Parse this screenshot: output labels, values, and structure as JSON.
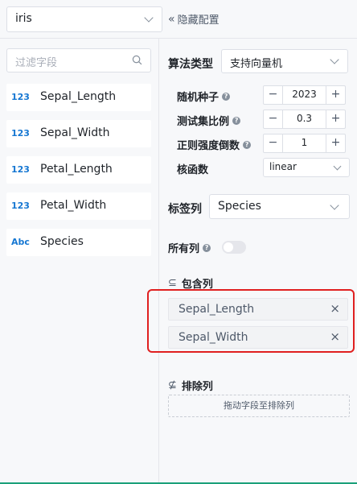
{
  "topbar": {
    "dataset_value": "iris",
    "hide_config_label": "隐藏配置",
    "hide_glyph": "«"
  },
  "left": {
    "search_placeholder": "过滤字段",
    "fields": [
      {
        "type": "123",
        "name": "Sepal_Length"
      },
      {
        "type": "123",
        "name": "Sepal_Width"
      },
      {
        "type": "123",
        "name": "Petal_Length"
      },
      {
        "type": "123",
        "name": "Petal_Width"
      },
      {
        "type": "Abc",
        "name": "Species"
      }
    ]
  },
  "right": {
    "algorithm_label": "算法类型",
    "algorithm_value": "支持向量机",
    "params": {
      "seed_label": "随机种子",
      "seed_value": "2023",
      "test_ratio_label": "测试集比例",
      "test_ratio_value": "0.3",
      "reg_label": "正则强度倒数",
      "reg_value": "1",
      "kernel_label": "核函数",
      "kernel_value": "linear",
      "minus": "−",
      "plus": "+",
      "help": "?"
    },
    "target_label": "标签列",
    "target_value": "Species",
    "all_cols_label": "所有列",
    "include_title": "包含列",
    "include_icon": "⊆",
    "included": [
      "Sepal_Length",
      "Sepal_Width"
    ],
    "close_glyph": "×",
    "exclude_title": "排除列",
    "exclude_icon": "⊈",
    "exclude_drop_hint": "拖动字段至排除列"
  },
  "colors": {
    "accent_type": "#1677d2",
    "highlight": "#e02020",
    "bottom_line": "#1aa07a"
  }
}
